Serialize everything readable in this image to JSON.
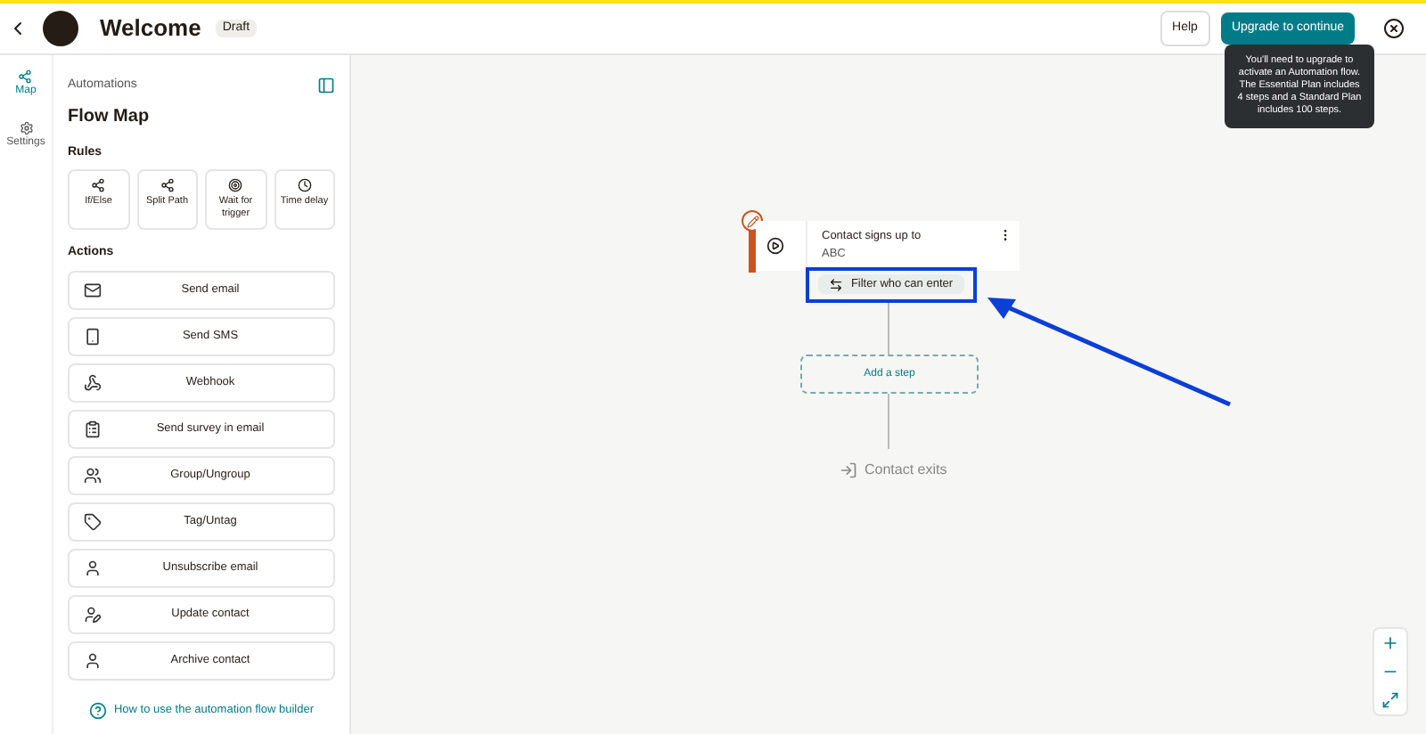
{
  "header": {
    "title": "Welcome",
    "badge": "Draft",
    "help": "Help",
    "upgrade": "Upgrade to continue",
    "tooltip": "You'll need to upgrade to activate an Automation flow. The Essential Plan includes 4 steps and a Standard Plan includes 100 steps."
  },
  "rail": [
    {
      "label": "Map",
      "selected": true
    },
    {
      "label": "Settings",
      "selected": false
    }
  ],
  "sidebar": {
    "section": "Automations",
    "title": "Flow Map",
    "rules_heading": "Rules",
    "rules": [
      {
        "label": "If/Else",
        "kind": "split"
      },
      {
        "label": "Split Path",
        "kind": "split"
      },
      {
        "label": "Wait for trigger",
        "kind": "target"
      },
      {
        "label": "Time delay",
        "kind": "clock"
      }
    ],
    "actions_heading": "Actions",
    "actions": [
      {
        "label": "Send email",
        "kind": "mail"
      },
      {
        "label": "Send SMS",
        "kind": "phone"
      },
      {
        "label": "Webhook",
        "kind": "webhook"
      },
      {
        "label": "Send survey in email",
        "kind": "survey"
      },
      {
        "label": "Group/Ungroup",
        "kind": "group"
      },
      {
        "label": "Tag/Untag",
        "kind": "tag"
      },
      {
        "label": "Unsubscribe email",
        "kind": "person"
      },
      {
        "label": "Update contact",
        "kind": "update"
      },
      {
        "label": "Archive contact",
        "kind": "person"
      }
    ],
    "help_link": "How to use the automation flow builder"
  },
  "flow": {
    "trigger": "Contact signs up to",
    "audience": "ABC",
    "filter": "Filter who can enter",
    "add_step": "Add a step",
    "exit": "Contact exits"
  }
}
